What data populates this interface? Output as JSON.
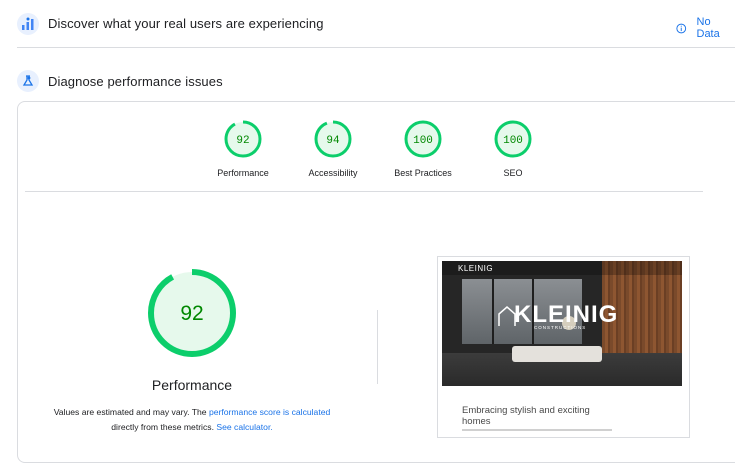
{
  "header": {
    "discover_title": "Discover what your real users are experiencing",
    "no_data_label": "No Data",
    "diagnose_title": "Diagnose performance issues"
  },
  "scores": [
    {
      "label": "Performance",
      "value": "92",
      "fraction": 0.92
    },
    {
      "label": "Accessibility",
      "value": "94",
      "fraction": 0.94
    },
    {
      "label": "Best Practices",
      "value": "100",
      "fraction": 1.0
    },
    {
      "label": "SEO",
      "value": "100",
      "fraction": 1.0
    }
  ],
  "main": {
    "score": "92",
    "fraction": 0.92,
    "label": "Performance",
    "note_prefix": "Values are estimated and may vary. The ",
    "note_link1": "performance score is calculated",
    "note_mid": "directly from these metrics. ",
    "note_link2": "See calculator."
  },
  "screenshot": {
    "nav_logo": "KLEINIG",
    "brand": "KLEINIG",
    "brand_sub": "CONSTRUCTIONS",
    "heading": "Embracing stylish and exciting homes"
  },
  "colors": {
    "pass_stroke": "#0cce6b",
    "pass_text": "#008800",
    "pass_fill": "#e6f9ec",
    "accent": "#1a73e8"
  }
}
